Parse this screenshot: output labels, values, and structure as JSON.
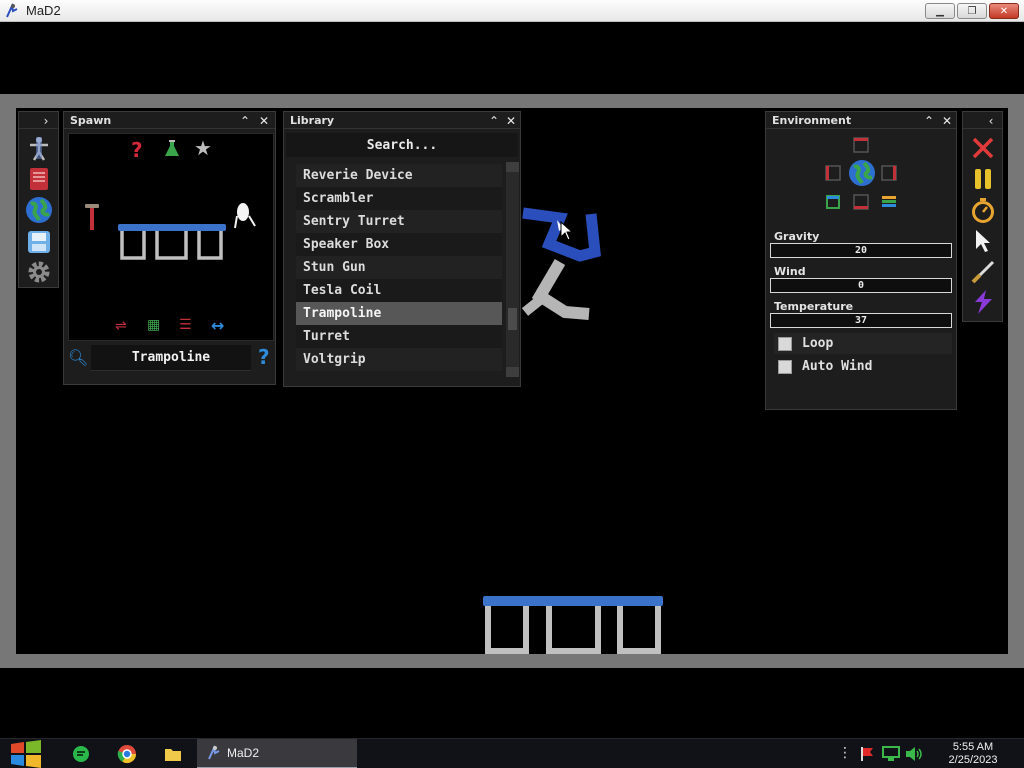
{
  "window": {
    "title": "MaD2",
    "minimize_icon": "minimize-icon",
    "maximize_icon": "restore-icon",
    "close_icon": "close-icon"
  },
  "left_toolbar": {
    "items": [
      "ragdoll-icon",
      "book-icon",
      "globe-icon",
      "save-icon",
      "gear-icon"
    ]
  },
  "spawn": {
    "title": "Spawn",
    "selected_name": "Trampoline",
    "filter_icons": [
      "sliders-icon",
      "grid-icon",
      "list-icon",
      "arrows-icon"
    ],
    "category_icons": [
      "question-icon",
      "flask-icon",
      "star-icon"
    ]
  },
  "library": {
    "title": "Library",
    "search_placeholder": "Search...",
    "items": [
      {
        "label": "Reverie Device",
        "selected": false
      },
      {
        "label": "Scrambler",
        "selected": false
      },
      {
        "label": "Sentry Turret",
        "selected": false
      },
      {
        "label": "Speaker Box",
        "selected": false
      },
      {
        "label": "Stun Gun",
        "selected": false
      },
      {
        "label": "Tesla Coil",
        "selected": false
      },
      {
        "label": "Trampoline",
        "selected": true
      },
      {
        "label": "Turret",
        "selected": false
      },
      {
        "label": "Voltgrip",
        "selected": false
      }
    ]
  },
  "environment": {
    "title": "Environment",
    "gravity": {
      "label": "Gravity",
      "value": "20"
    },
    "wind": {
      "label": "Wind",
      "value": "0"
    },
    "temperature": {
      "label": "Temperature",
      "value": "37"
    },
    "loop": {
      "label": "Loop",
      "checked": false
    },
    "auto_wind": {
      "label": "Auto Wind",
      "checked": false
    }
  },
  "right_toolbar": {
    "items": [
      "delete-icon",
      "pause-icon",
      "stopwatch-icon",
      "cursor-icon",
      "knife-icon",
      "lightning-icon"
    ]
  },
  "taskbar": {
    "task_label": "MaD2",
    "time": "5:55 AM",
    "date": "2/25/2023"
  },
  "colors": {
    "trampoline_top": "#3a73c9",
    "trampoline_frame": "#c0c0c0",
    "ragdoll_blue": "#2a4fbd",
    "ragdoll_gray": "#b5b5b5",
    "panel_bg": "#1d1d1d"
  }
}
